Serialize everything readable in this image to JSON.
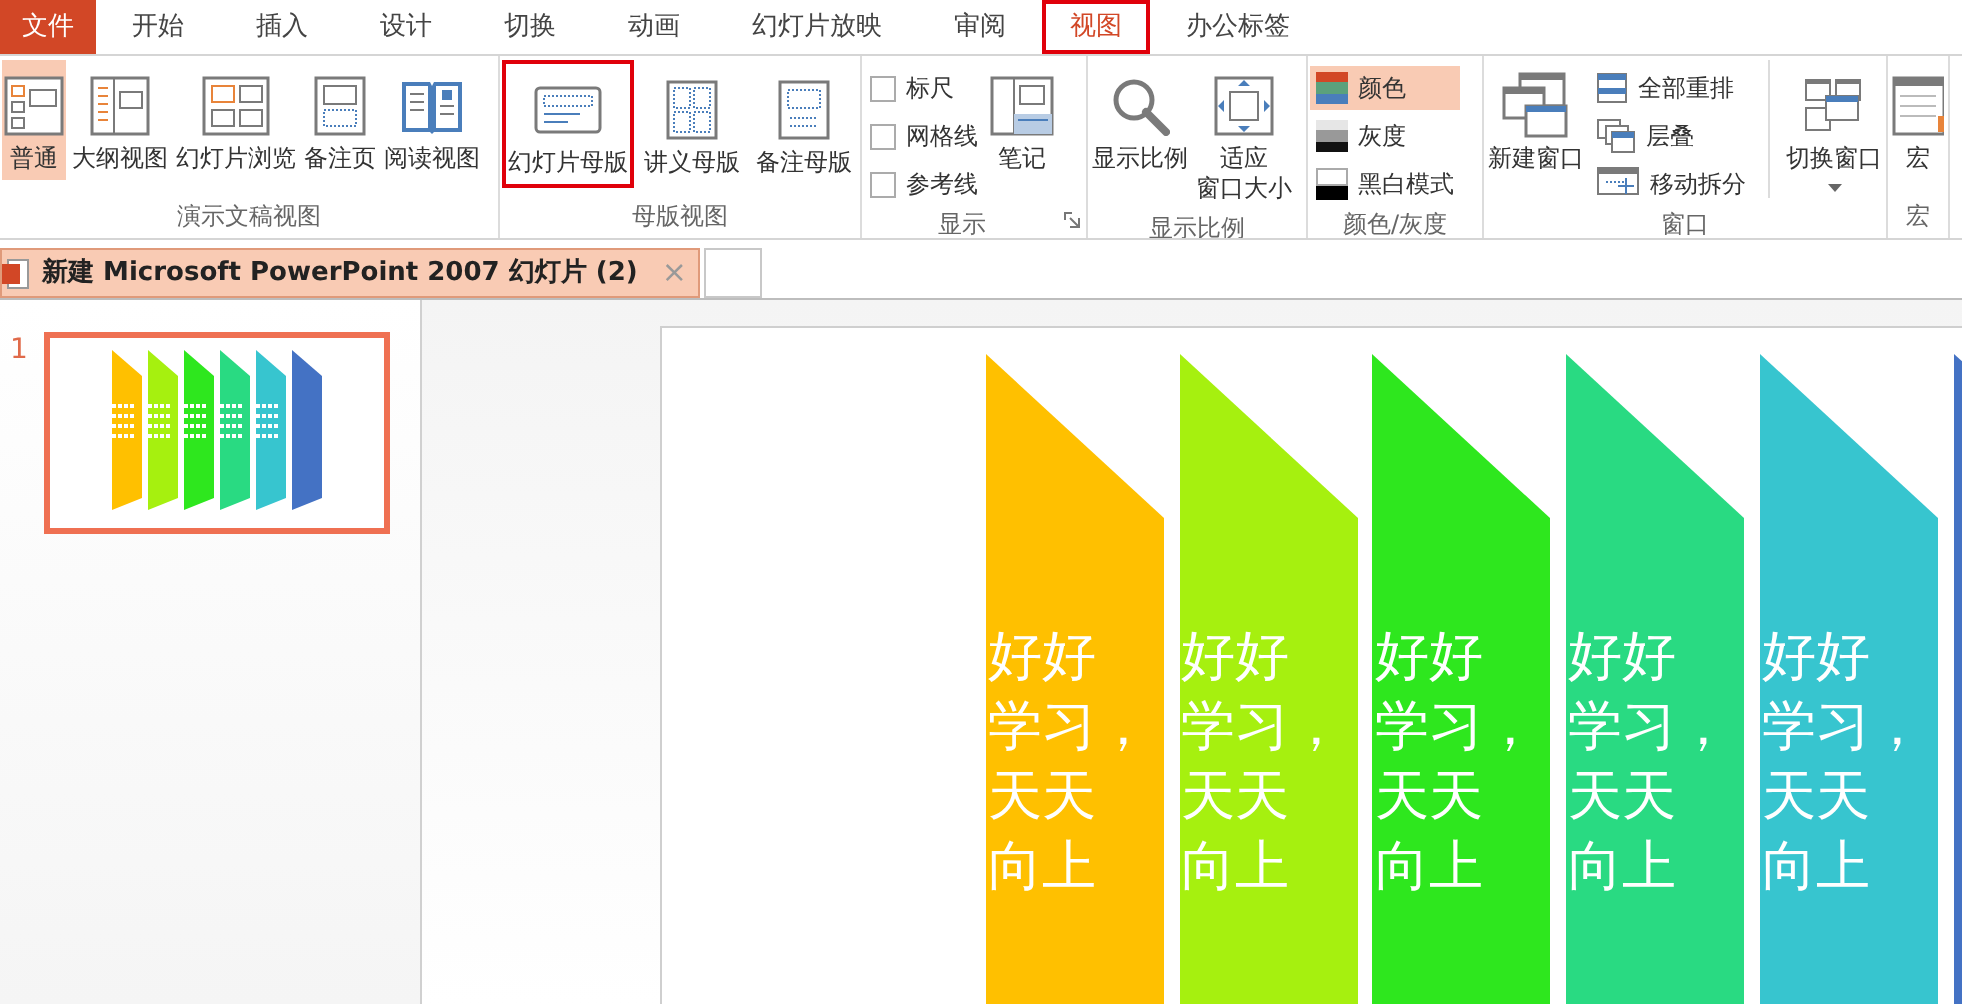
{
  "tabs": [
    {
      "label": "文件",
      "kind": "file"
    },
    {
      "label": "开始",
      "selected": false,
      "highlighted": false
    },
    {
      "label": "插入",
      "selected": false,
      "highlighted": false
    },
    {
      "label": "设计",
      "selected": false,
      "highlighted": false
    },
    {
      "label": "切换",
      "selected": false,
      "highlighted": false
    },
    {
      "label": "动画",
      "selected": false,
      "highlighted": false
    },
    {
      "label": "幻灯片放映",
      "selected": false,
      "highlighted": false
    },
    {
      "label": "审阅",
      "selected": false,
      "highlighted": false
    },
    {
      "label": "视图",
      "selected": true,
      "highlighted": true
    },
    {
      "label": "办公标签",
      "selected": false,
      "highlighted": false
    }
  ],
  "ribbon_groups": [
    {
      "label": "演示文稿视图",
      "items": [
        {
          "kind": "large",
          "label": "普通",
          "selected": true
        },
        {
          "kind": "large",
          "label": "大纲视图",
          "selected": false
        },
        {
          "kind": "large",
          "label": "幻灯片浏览",
          "selected": false
        },
        {
          "kind": "large",
          "label": "备注页",
          "selected": false
        },
        {
          "kind": "large",
          "label": "阅读视图",
          "selected": false
        }
      ]
    },
    {
      "label": "母版视图",
      "items": [
        {
          "kind": "large",
          "label": "幻灯片母版",
          "highlighted": true
        },
        {
          "kind": "large",
          "label": "讲义母版",
          "highlighted": false
        },
        {
          "kind": "large",
          "label": "备注母版",
          "highlighted": false
        }
      ]
    },
    {
      "label": "显示",
      "launcher": true,
      "items": [
        {
          "kind": "checkbox",
          "label": "标尺",
          "checked": false
        },
        {
          "kind": "checkbox",
          "label": "网格线",
          "checked": false
        },
        {
          "kind": "checkbox",
          "label": "参考线",
          "checked": false
        },
        {
          "kind": "large",
          "label": "笔记"
        }
      ]
    },
    {
      "label": "显示比例",
      "items": [
        {
          "kind": "large",
          "label": "显示比例"
        },
        {
          "kind": "large",
          "label_lines": [
            "适应",
            "窗口大小"
          ]
        }
      ]
    },
    {
      "label": "颜色/灰度",
      "items": [
        {
          "kind": "small",
          "label": "颜色",
          "selected": true
        },
        {
          "kind": "small",
          "label": "灰度",
          "selected": false
        },
        {
          "kind": "small",
          "label": "黑白模式",
          "selected": false
        }
      ]
    },
    {
      "label": "窗口",
      "items": [
        {
          "kind": "large",
          "label": "新建窗口"
        },
        {
          "kind": "small",
          "label": "全部重排"
        },
        {
          "kind": "small",
          "label": "层叠"
        },
        {
          "kind": "small",
          "label": "移动拆分"
        },
        {
          "kind": "dropdown",
          "label": "切换窗口"
        }
      ]
    },
    {
      "label": "宏",
      "items": [
        {
          "kind": "large",
          "label": "宏"
        }
      ]
    }
  ],
  "document_tabs": [
    {
      "title": "新建 Microsoft PowerPoint 2007 幻灯片 (2)",
      "close": "×",
      "selected": true
    }
  ],
  "thumbnails": [
    {
      "number": "1",
      "selected": true
    }
  ],
  "slide": {
    "columns": [
      {
        "color": "#ffc000",
        "lines": [
          "好好",
          "学习，",
          "天天",
          "向上"
        ]
      },
      {
        "color": "#a6f00f",
        "lines": [
          "好好",
          "学习，",
          "天天",
          "向上"
        ]
      },
      {
        "color": "#2ee71e",
        "lines": [
          "好好",
          "学习，",
          "天天",
          "向上"
        ]
      },
      {
        "color": "#29da82",
        "lines": [
          "好好",
          "学习，",
          "天天",
          "向上"
        ]
      },
      {
        "color": "#37c5cf",
        "lines": [
          "好好",
          "学习，",
          "天天",
          "向上"
        ]
      },
      {
        "color": "#4472c4"
      }
    ]
  }
}
